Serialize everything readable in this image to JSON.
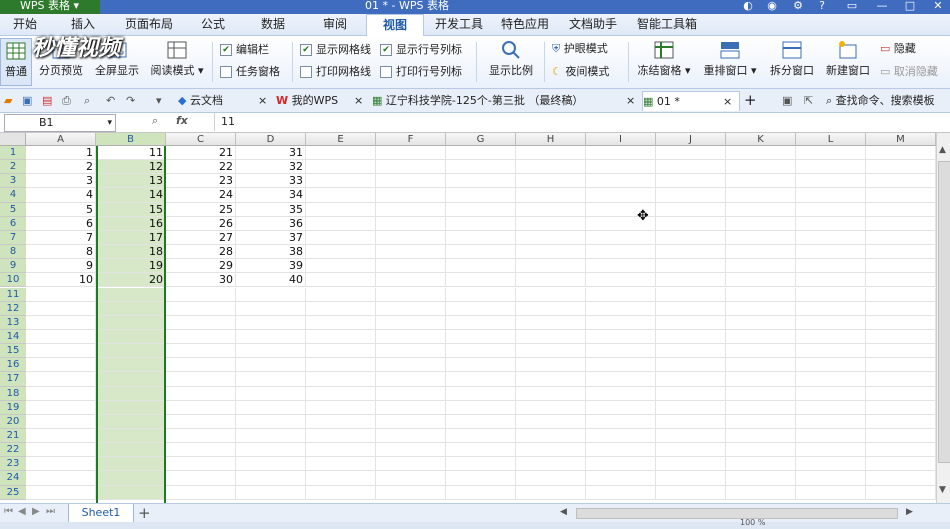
{
  "window": {
    "app_name": "WPS 表格",
    "title": "01 * - WPS 表格",
    "controls": [
      "▭",
      "—",
      "□",
      "✕"
    ]
  },
  "ribbon_tabs": [
    {
      "label": "开始"
    },
    {
      "label": "插入"
    },
    {
      "label": "页面布局"
    },
    {
      "label": "公式"
    },
    {
      "label": "数据"
    },
    {
      "label": "审阅"
    },
    {
      "label": "视图",
      "active": true
    },
    {
      "label": "开发工具"
    },
    {
      "label": "特色应用"
    },
    {
      "label": "文档助手"
    },
    {
      "label": "智能工具箱"
    }
  ],
  "ribbon": {
    "normal": "普通",
    "page_break_preview": "分页预览",
    "full_screen": "全屏显示",
    "reading_mode": "阅读模式",
    "edit_bar": "编辑栏",
    "task_pane": "任务窗格",
    "show_gridlines": "显示网格线",
    "print_gridlines": "打印网格线",
    "show_headings": "显示行号列标",
    "print_headings": "打印行号列标",
    "zoom": "显示比例",
    "eye_protect": "护眼模式",
    "night_mode": "夜间模式",
    "freeze_panes": "冻结窗格",
    "rearrange": "重排窗口",
    "split_window": "拆分窗口",
    "new_window": "新建窗口",
    "hide": "隐藏",
    "unhide": "取消隐藏",
    "watermark": "秒懂视频"
  },
  "doc_tabs": [
    {
      "label": "云文档"
    },
    {
      "label": "我的WPS"
    },
    {
      "label": "辽宁科技学院-125个-第三批 （最终稿）"
    },
    {
      "label": "01 *",
      "active": true
    }
  ],
  "search": {
    "placeholder": "查找命令、搜索模板"
  },
  "formula_bar": {
    "name_box": "B1",
    "fx": "fx",
    "value": "11"
  },
  "columns": [
    "A",
    "B",
    "C",
    "D",
    "E",
    "F",
    "G",
    "H",
    "I",
    "J",
    "K",
    "L",
    "M"
  ],
  "rows": [
    "1",
    "2",
    "3",
    "4",
    "5",
    "6",
    "7",
    "8",
    "9",
    "10",
    "11",
    "12",
    "13",
    "14",
    "15",
    "16",
    "17",
    "18",
    "19",
    "20",
    "21",
    "22",
    "23",
    "24",
    "25"
  ],
  "cells": {
    "A": [
      "1",
      "2",
      "3",
      "4",
      "5",
      "6",
      "7",
      "8",
      "9",
      "10"
    ],
    "B": [
      "11",
      "12",
      "13",
      "14",
      "15",
      "16",
      "17",
      "18",
      "19",
      "20"
    ],
    "C": [
      "21",
      "22",
      "23",
      "24",
      "25",
      "26",
      "27",
      "28",
      "29",
      "30"
    ],
    "D": [
      "31",
      "32",
      "33",
      "34",
      "35",
      "36",
      "37",
      "38",
      "39",
      "40"
    ]
  },
  "sheet_tabs": [
    {
      "label": "Sheet1",
      "active": true
    }
  ],
  "status": {
    "zoom": "100 %"
  },
  "colors": {
    "title_bar": "#3f6cbf",
    "app_button": "#2d7a2d",
    "selection": "#d6e8c8",
    "selection_border": "#1e7a1e"
  }
}
